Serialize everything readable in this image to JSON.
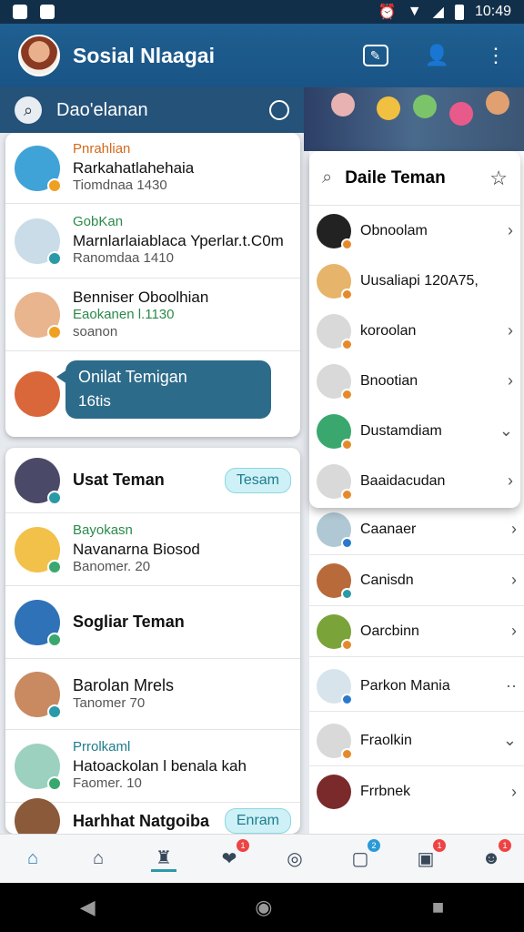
{
  "status": {
    "time": "10:49"
  },
  "app": {
    "title": "Sosial Nlaagai"
  },
  "search": {
    "text": "Dao'elanan"
  },
  "chats": [
    {
      "l1": "Pnrahlian",
      "l2": "Rarkahatlahehaia",
      "l3": "Tiomdnaa 1430",
      "color": "#3fa3d8"
    },
    {
      "l1": "GobKan",
      "l2": "Marnlarlaiablaca Yperlar.t.C0m",
      "l3": "Ranomdaa 1410",
      "color": "#c9dce8"
    },
    {
      "l1": "Benniser Oboolhian",
      "l2": "Eaokanen l.1130",
      "l3": "soanon",
      "color": "#e9b58e"
    },
    {
      "l1": "Onilat Temigan",
      "l2": "16tis",
      "color": "#d9673a"
    }
  ],
  "friends": [
    {
      "name": "Usat Teman",
      "chip": "Tesam",
      "color": "#4a4a68"
    },
    {
      "l1": "Bayokasn",
      "l2": "Navanarna Biosod",
      "l3": "Banomer. 20",
      "color": "#f2c14a"
    },
    {
      "name": "Sogliar Teman",
      "color": "#2f72b8"
    },
    {
      "name": "Barolan Mrels",
      "l3": "Tanomer 70",
      "color": "#c98a62"
    },
    {
      "l1": "Prrolkaml",
      "l2": "Hatoackolan l benala kah",
      "l3": "Faomer. 10",
      "color": "#9cd1c0"
    },
    {
      "name": "Harhhat Natgoiba",
      "chip": "Enram",
      "color": "#8a5a3a"
    }
  ],
  "popup": {
    "title": "Daile Teman",
    "items": [
      {
        "name": "Obnoolam",
        "color": "#222"
      },
      {
        "name": "Uusaliapi 120A75,",
        "color": "#e6b46a"
      },
      {
        "name": "koroolan",
        "color": "#d9d9d9"
      },
      {
        "name": "Bnootian",
        "color": "#d9d9d9"
      },
      {
        "name": "Dustamdiam",
        "color": "#3aa86e"
      },
      {
        "name": "Baaidacudan",
        "color": "#d9d9d9"
      }
    ]
  },
  "contacts": [
    {
      "name": "Caanaer",
      "color": "#b0c8d4"
    },
    {
      "name": "Canisdn",
      "color": "#b86a3a"
    },
    {
      "name": "Oarcbinn",
      "color": "#7aa33a"
    },
    {
      "name": "Parkon Mania",
      "color": "#d8e4ec"
    },
    {
      "name": "Fraolkin",
      "color": "#d9d9d9"
    },
    {
      "name": "Frrbnek",
      "color": "#7a2a2a"
    }
  ],
  "nav": [
    {
      "icon": "home-icon",
      "glyph": "⌂"
    },
    {
      "icon": "house-outline-icon",
      "glyph": "⌂"
    },
    {
      "icon": "profile-icon",
      "glyph": "♜"
    },
    {
      "icon": "heart-icon",
      "glyph": "❤"
    },
    {
      "icon": "camera-icon",
      "glyph": "◎"
    },
    {
      "icon": "message-icon",
      "glyph": "▢"
    },
    {
      "icon": "screen-icon",
      "glyph": "▣"
    },
    {
      "icon": "avatar-icon",
      "glyph": "☻"
    }
  ]
}
